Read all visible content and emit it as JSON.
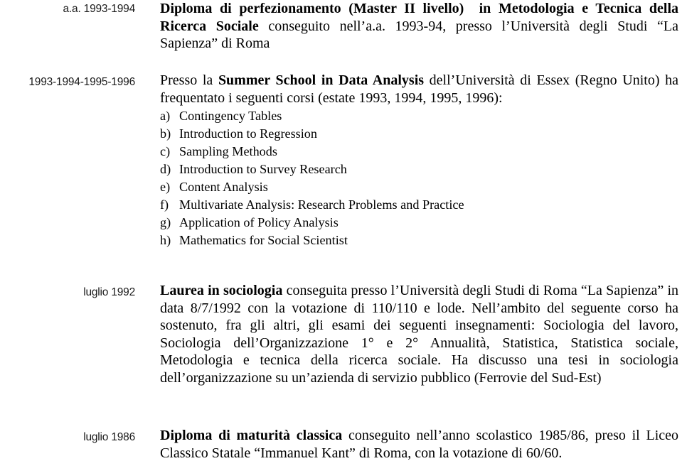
{
  "document": {
    "type": "curriculum-vitae-education-section",
    "background_color": "#ffffff",
    "text_color": "#000000"
  },
  "entries": [
    {
      "id": "postgrad",
      "date_label": "a.a. 1993-1994",
      "body_html": "<b>Diploma di perfezionamento (Master II livello)</b>&nbsp; <b>in Metodologia e Tecnica della Ricerca Sociale</b> conseguito nell’a.a. 1993-94, presso l’Università degli Studi “La Sapienza” di Roma",
      "body_text": "Diploma di perfezionamento (Master II livello) in Metodologia e Tecnica della Ricerca Sociale conseguito nell’a.a. 1993-94, presso l’Università degli Studi “La Sapienza” di Roma"
    },
    {
      "id": "summer",
      "date_label": "1993-1994-1995-1996",
      "body_html": "Presso la <b>Summer School in Data Analysis</b> dell’Università di Essex (Regno Unito) ha frequentato i seguenti corsi (estate 1993, 1994, 1995, 1996):",
      "body_text": "Presso la Summer School in Data Analysis dell’Università di Essex (Regno Unito) ha frequentato i seguenti corsi (estate 1993, 1994, 1995, 1996):",
      "courses": [
        {
          "marker": "a)",
          "title": "Contingency Tables"
        },
        {
          "marker": "b)",
          "title": "Introduction to Regression"
        },
        {
          "marker": "c)",
          "title": "Sampling Methods"
        },
        {
          "marker": "d)",
          "title": "Introduction to Survey Research"
        },
        {
          "marker": "e)",
          "title": "Content Analysis"
        },
        {
          "marker": "f)",
          "title": "Multivariate Analysis: Research Problems and Practice"
        },
        {
          "marker": "g)",
          "title": "Application of Policy Analysis"
        },
        {
          "marker": "h)",
          "title": "Mathematics for Social Scientist"
        }
      ]
    },
    {
      "id": "laurea",
      "date_label": "luglio 1992",
      "body_html": "<b>Laurea in sociologia</b> conseguita presso l’Università degli Studi di Roma “La Sapienza” in data 8/7/1992 con la votazione di 110/110 e lode. Nell’ambito del seguente corso ha sostenuto, fra gli altri, gli esami dei seguenti insegnamenti: Sociologia del lavoro, Sociologia dell’Organizzazione 1° e 2° Annualità, Statistica, Statistica sociale, Metodologia e tecnica della ricerca sociale. Ha discusso una tesi in sociologia dell’organizzazione su un’azienda di servizio pubblico (Ferrovie del Sud-Est)",
      "body_text": "Laurea in sociologia conseguita presso l’Università degli Studi di Roma “La Sapienza” in data 8/7/1992 con la votazione di 110/110 e lode. Nell’ambito del seguente corso ha sostenuto, fra gli altri, gli esami dei seguenti insegnamenti: Sociologia del lavoro, Sociologia dell’Organizzazione 1° e 2° Annualità, Statistica, Statistica sociale, Metodologia e tecnica della ricerca sociale. Ha discusso una tesi in sociologia dell’organizzazione su un’azienda di servizio pubblico (Ferrovie del Sud-Est)"
    },
    {
      "id": "maturita",
      "date_label": "luglio 1986",
      "body_html": "<b>Diploma di maturità classica</b> conseguito nell’anno scolastico 1985/86, preso il Liceo Classico Statale “Immanuel Kant” di Roma, con la votazione di 60/60.",
      "body_text": "Diploma di maturità classica conseguito nell’anno scolastico 1985/86, preso il Liceo Classico Statale “Immanuel Kant” di Roma, con la votazione di 60/60."
    }
  ]
}
